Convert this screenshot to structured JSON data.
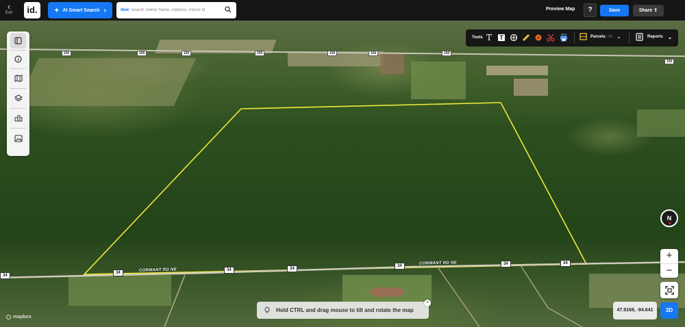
{
  "topbar": {
    "exit_label": "Exit",
    "logo_text": "id.",
    "ai_search_label": "AI Smart Search",
    "search_new_badge": "New",
    "search_placeholder": "Search Owner Name, Address, Parcel Id",
    "preview_label": "Preview Map",
    "help_label": "?",
    "save_label": "Save",
    "share_label": "Share"
  },
  "left_toolbar": {
    "icons": [
      "panel-icon",
      "info-icon",
      "map-icon",
      "layers-icon",
      "buildings-icon",
      "image-icon"
    ]
  },
  "tools_bar": {
    "tools_label": "Tools",
    "tool_icons": [
      "text-icon",
      "text-box-icon",
      "measure-icon",
      "ruler-icon",
      "circle-icon",
      "scissors-icon",
      "print-icon"
    ],
    "parcels_label": "Parcels:",
    "parcels_state": "Off",
    "reports_label": "Reports"
  },
  "map": {
    "highway_shield": "34",
    "road_name": "CORMANT RD NE",
    "top_road_shield": "150",
    "compass_label": "N",
    "coordinates": "47.9168, -94.641",
    "mode_3d_label": "3D",
    "hint_text": "Hold CTRL and drag mouse to tilt and rotate the map",
    "attribution": "mapbox",
    "colors": {
      "parcel_outline": "#f2ea3a",
      "accent": "#1577f2"
    }
  }
}
